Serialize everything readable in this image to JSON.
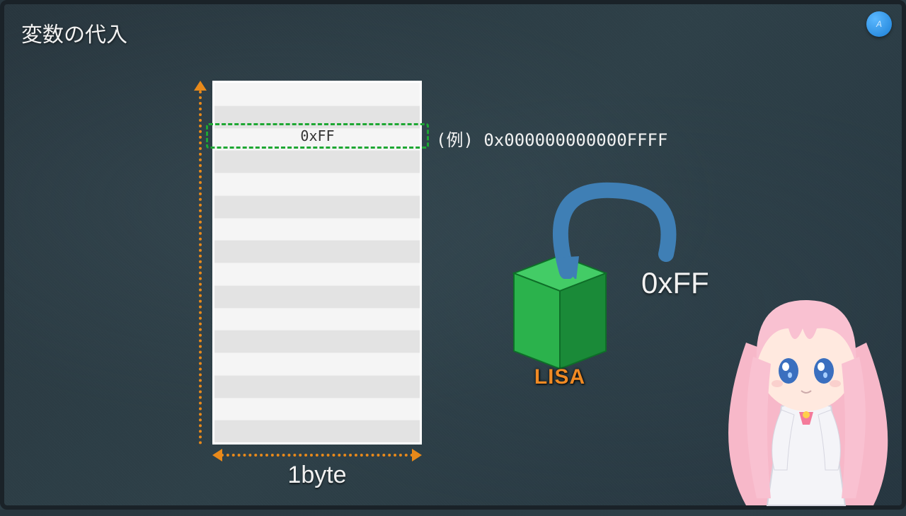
{
  "title": "変数の代入",
  "memory": {
    "highlighted_value": "0xFF",
    "width_label": "1byte"
  },
  "address": {
    "prefix": "(例)",
    "value": "0x000000000000FFFF"
  },
  "cube": {
    "name": "LISA",
    "value": "0xFF"
  },
  "colors": {
    "accent": "#e8891a",
    "highlight_border": "#1ea733",
    "cube_front": "#2bb24c",
    "cube_top": "#43cc66",
    "cube_side": "#1a8a38",
    "arrow": "#3f7fb5"
  }
}
